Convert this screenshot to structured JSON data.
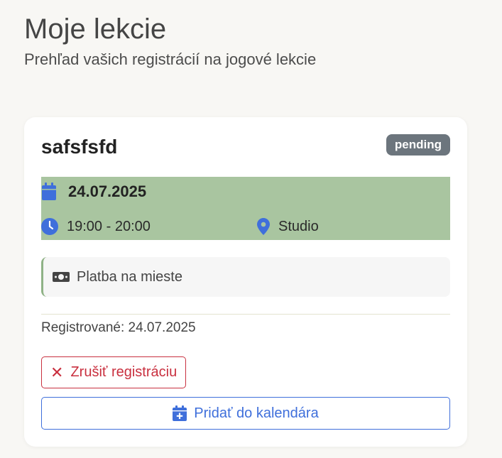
{
  "header": {
    "title": "Moje lekcie",
    "subtitle": "Prehľad vašich registrácií na jogové lekcie"
  },
  "lesson": {
    "title": "safsfsfd",
    "status": "pending",
    "date": "24.07.2025",
    "time": "19:00 - 20:00",
    "place": "Studio",
    "payment": "Platba na mieste",
    "registered": "Registrované: 24.07.2025",
    "cancel_label": "Zrušiť registráciu",
    "calendar_label": "Pridať do kalendára",
    "icons": {
      "date": "calendar-icon",
      "time": "clock-icon",
      "place": "map-pin-icon",
      "payment": "cash-icon",
      "cancel": "close-icon",
      "calendar": "calendar-plus-icon"
    }
  },
  "colors": {
    "accent": "#3f6fdb",
    "info_bg": "#a9c5a0",
    "danger": "#c9303f",
    "badge": "#6c757d"
  }
}
